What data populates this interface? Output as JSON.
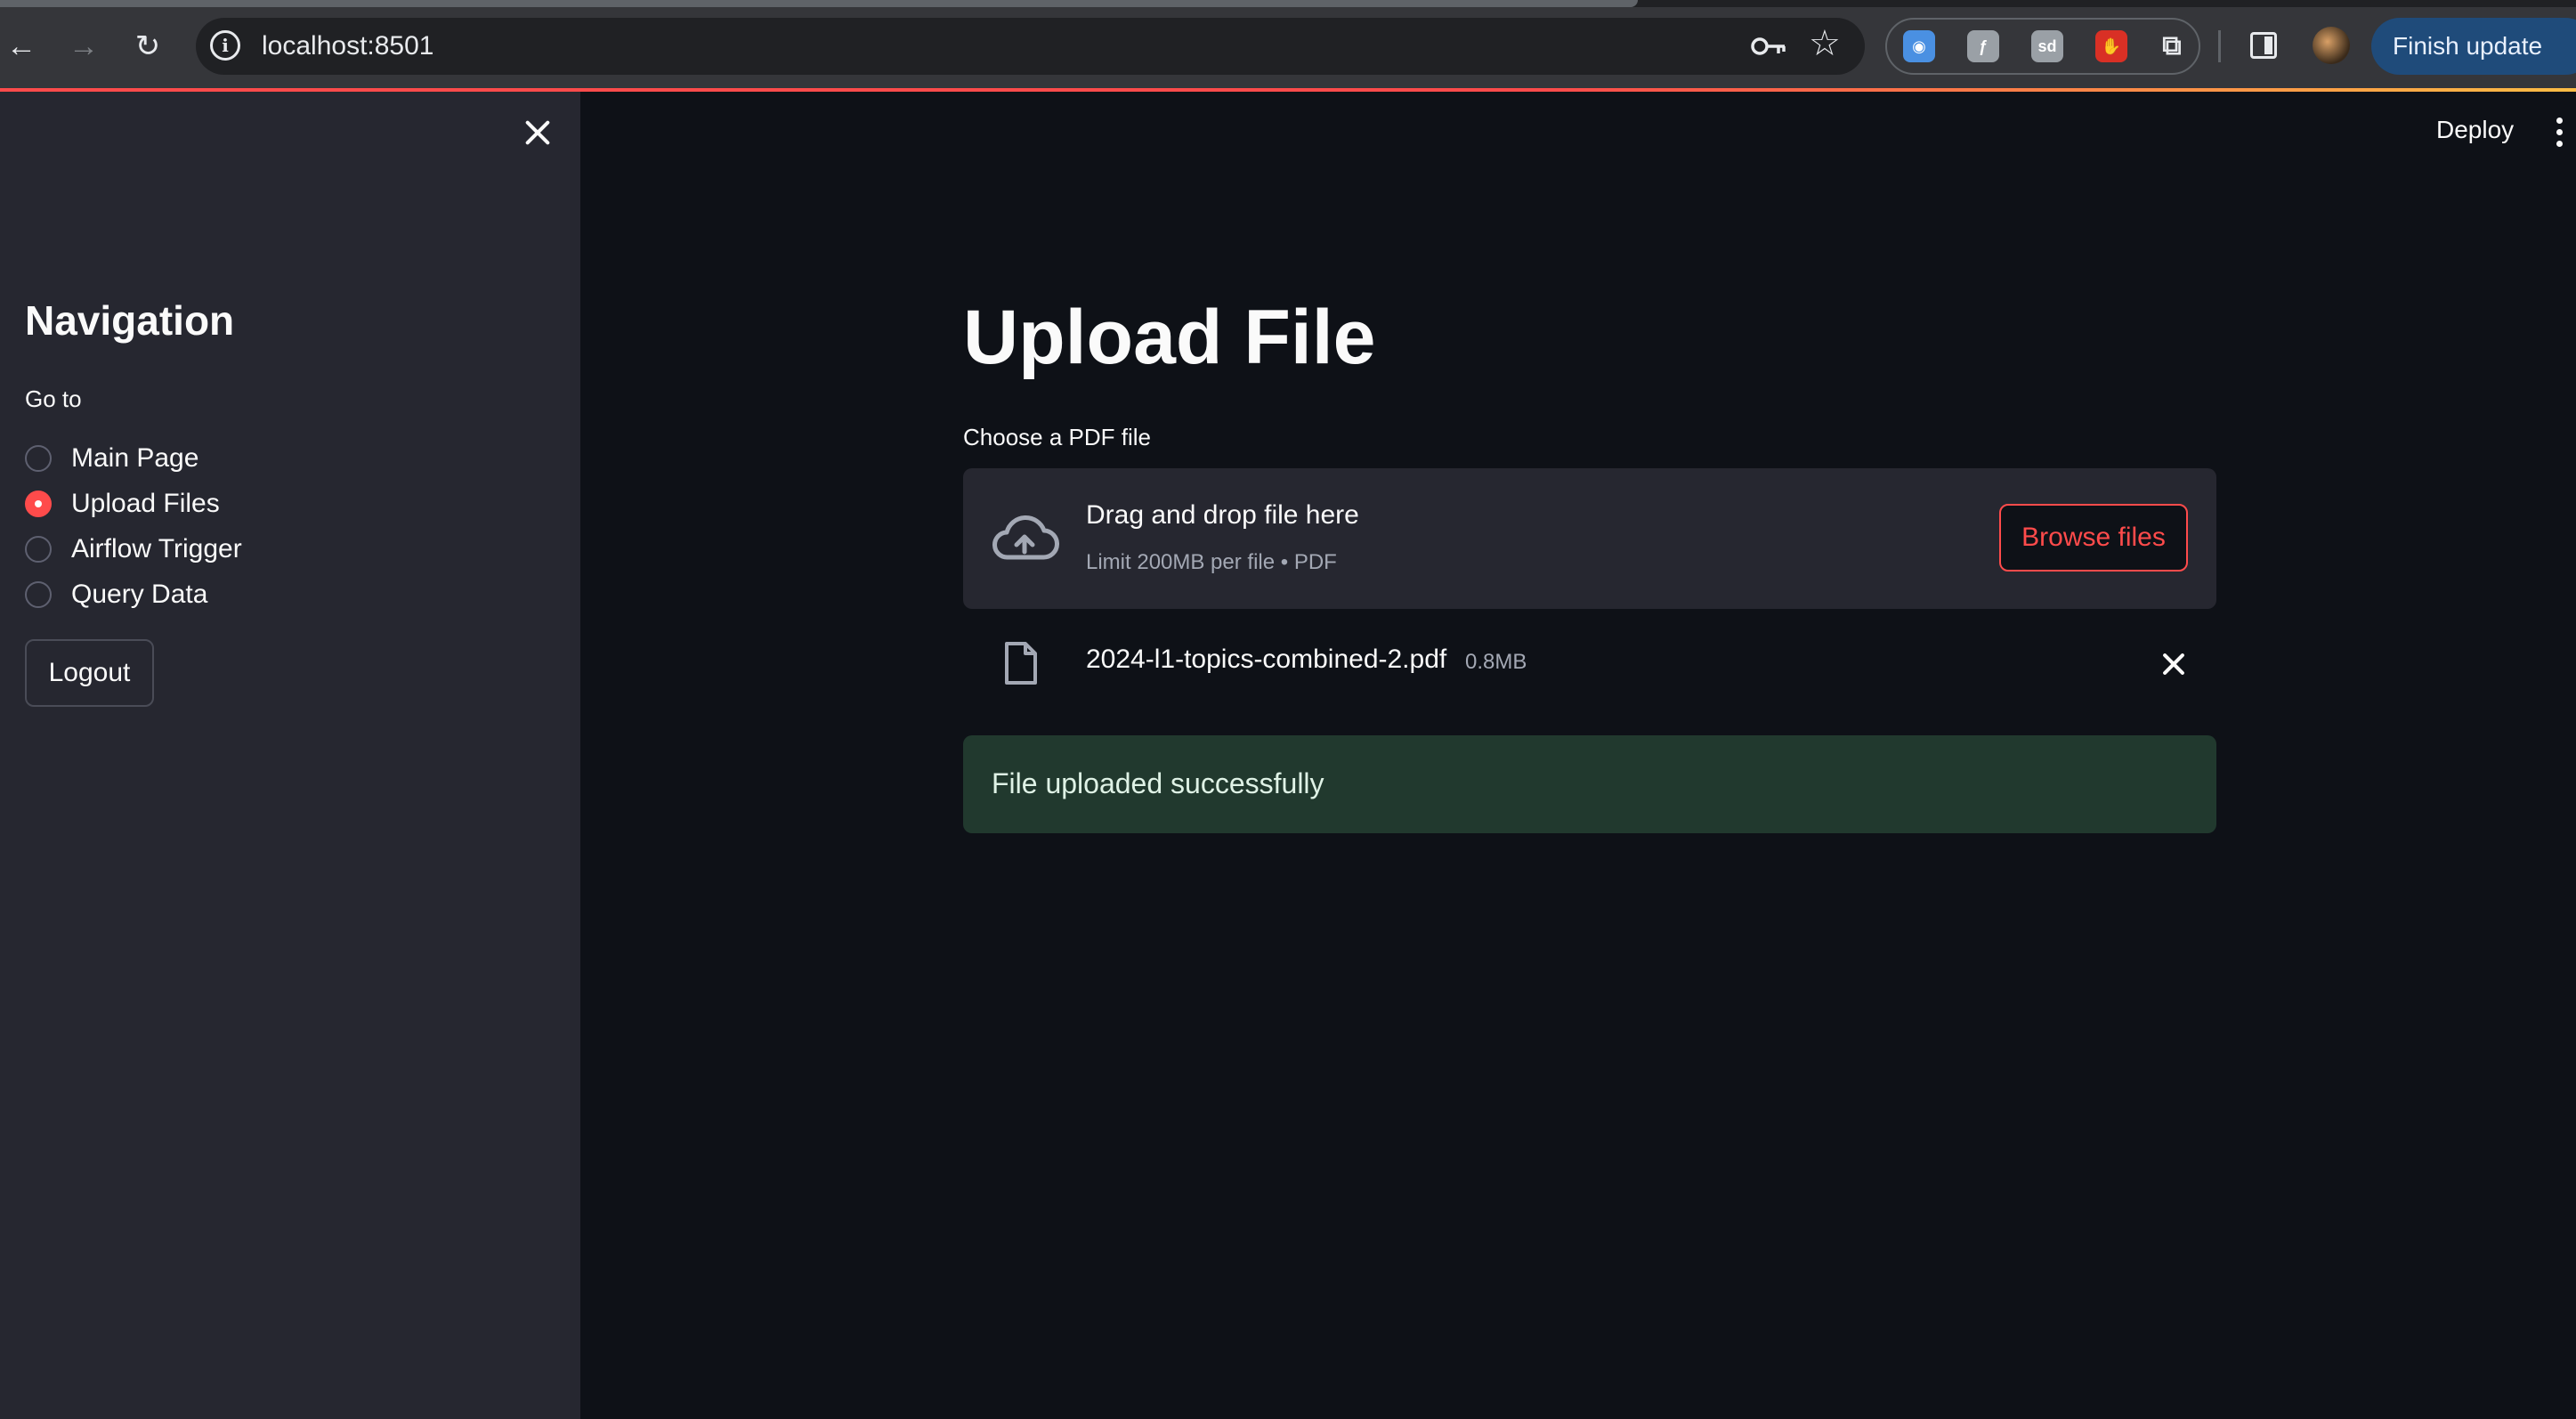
{
  "browser": {
    "url": "localhost:8501",
    "finish_update": "Finish update",
    "extensions": [
      {
        "name": "chrome-extension-icon-1",
        "glyph": "◉",
        "color": "#4a90e2"
      },
      {
        "name": "chrome-extension-icon-2",
        "glyph": "ƒ",
        "color": "#9aa0a6"
      },
      {
        "name": "chrome-extension-icon-3",
        "glyph": "sd",
        "color": "#9aa0a6"
      },
      {
        "name": "chrome-extension-icon-4",
        "glyph": "✋",
        "color": "#d93025"
      }
    ]
  },
  "header": {
    "deploy_label": "Deploy"
  },
  "sidebar": {
    "title": "Navigation",
    "radio_label": "Go to",
    "options": [
      {
        "label": "Main Page",
        "selected": false
      },
      {
        "label": "Upload Files",
        "selected": true
      },
      {
        "label": "Airflow Trigger",
        "selected": false
      },
      {
        "label": "Query Data",
        "selected": false
      }
    ],
    "logout_label": "Logout"
  },
  "main": {
    "title": "Upload File",
    "uploader_label": "Choose a PDF file",
    "dropzone": {
      "title": "Drag and drop file here",
      "subtitle": "Limit 200MB per file • PDF",
      "browse_label": "Browse files"
    },
    "uploaded_file": {
      "name": "2024-l1-topics-combined-2.pdf",
      "size": "0.8MB"
    },
    "success_message": "File uploaded successfully"
  },
  "colors": {
    "accent": "#ff4b4b",
    "sidebar_bg": "#262730",
    "main_bg": "#0e1117",
    "success_bg": "#21392e"
  }
}
